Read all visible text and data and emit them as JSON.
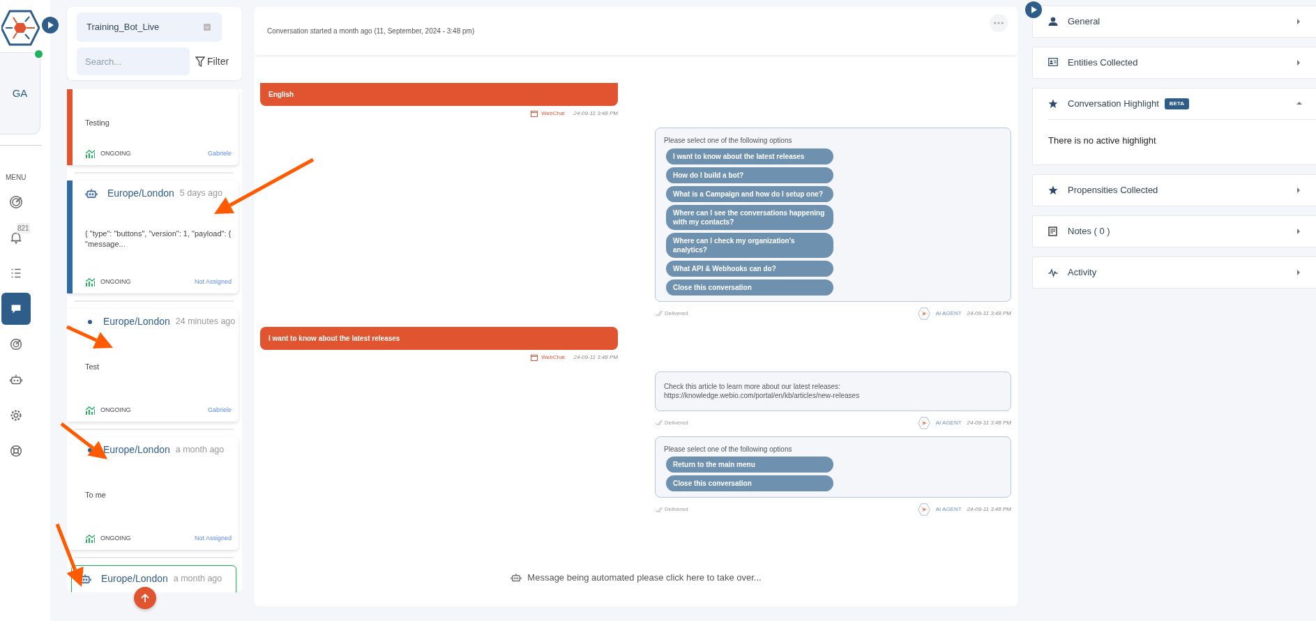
{
  "nav": {
    "avatar": "GA",
    "online": true,
    "menu_label": "MENU",
    "items": [
      {
        "selected": false
      },
      {
        "selected": false,
        "badge": "821"
      },
      {
        "selected": false
      },
      {
        "selected": true
      },
      {
        "selected": false
      },
      {
        "selected": false
      },
      {
        "selected": false
      },
      {
        "selected": false
      }
    ]
  },
  "bot_select": {
    "value": "Training_Bot_Live"
  },
  "search": {
    "placeholder": "Search..."
  },
  "filter_label": "Filter",
  "conversations": [
    {
      "selected": false,
      "color": "#e05430",
      "preview": "Testing",
      "status": "ONGOING",
      "assignee": "Gabriele"
    },
    {
      "selected": false,
      "color": "#2f6aa3",
      "kind": "bot",
      "title": "Europe/London",
      "time": "5 days ago",
      "preview": "{ \"type\": \"buttons\", \"version\": 1, \"payload\": { \"message...",
      "status": "ONGOING",
      "assignee": "Not Assigned"
    },
    {
      "selected": false,
      "kind": "dot",
      "title": "Europe/London",
      "time": "24 minutes ago",
      "preview": "Test",
      "status": "ONGOING",
      "assignee": "Gabriele"
    },
    {
      "selected": false,
      "kind": "dot",
      "title": "Europe/London",
      "time": "a month ago",
      "preview": "To me",
      "status": "ONGOING",
      "assignee": "Not Assigned"
    },
    {
      "selected": true,
      "kind": "bot",
      "title": "Europe/London",
      "time": "a month ago"
    }
  ],
  "chat": {
    "started": "Conversation started a month ago (11, September, 2024 - 3:48 pm)",
    "messages": [
      {
        "kind": "user",
        "text": "English",
        "channel": "WebChat",
        "time": "24-09-11 3:48 PM"
      },
      {
        "kind": "bot",
        "text": "Please select one of the following options",
        "options": [
          "I want to know about the latest releases",
          "How do I build a bot?",
          "What is a Campaign and how do I setup one?",
          "Where can I see the conversations happening with my contacts?",
          "Where can I check my organization's analytics?",
          "What API & Webhooks can do?",
          "Close this conversation"
        ],
        "status": "Delivered",
        "sender": "AI AGENT",
        "time": "24-09-11 3:48 PM"
      },
      {
        "kind": "user",
        "text": "I want to know about the latest releases",
        "channel": "WebChat",
        "time": "24-09-11 3:48 PM"
      },
      {
        "kind": "bot",
        "text": "Check this article to learn more about our latest releases: https://knowledge.webio.com/portal/en/kb/articles/new-releases",
        "status": "Delivered",
        "sender": "AI AGENT",
        "time": "24-09-11 3:48 PM"
      },
      {
        "kind": "bot",
        "text": "Please select one of the following options",
        "options": [
          "Return to the main menu",
          "Close this conversation"
        ],
        "status": "Delivered",
        "sender": "AI AGENT",
        "time": "24-09-11 3:48 PM"
      }
    ],
    "takeover": "Message being automated please click here to take over..."
  },
  "sections": [
    {
      "title": "General",
      "expanded": false
    },
    {
      "title": "Entities Collected",
      "expanded": false
    },
    {
      "title": "Conversation Highlight",
      "badge": "BETA",
      "expanded": true,
      "body": "There is no active highlight"
    },
    {
      "title": "Propensities Collected",
      "expanded": false
    },
    {
      "title": "Notes ( 0 )",
      "expanded": false
    },
    {
      "title": "Activity",
      "expanded": false
    }
  ],
  "annotations": [
    {
      "kind": "arrow"
    },
    {
      "kind": "arrow"
    },
    {
      "kind": "arrow"
    },
    {
      "kind": "arrow"
    }
  ]
}
